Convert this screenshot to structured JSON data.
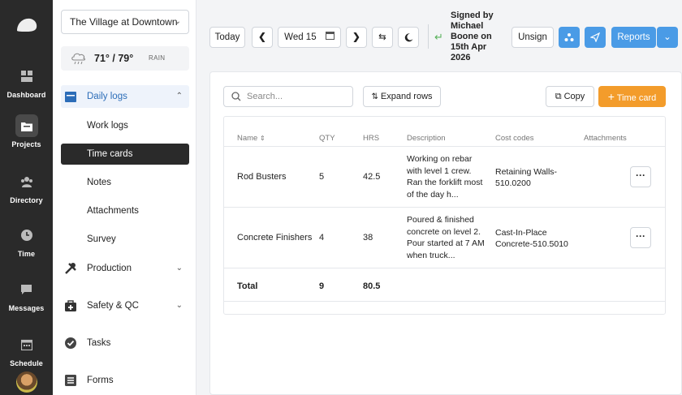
{
  "rail": {
    "items": [
      {
        "label": "Dashboard",
        "icon": "dashboard-icon"
      },
      {
        "label": "Projects",
        "icon": "folder-icon"
      },
      {
        "label": "Directory",
        "icon": "people-icon"
      },
      {
        "label": "Time",
        "icon": "clock-icon"
      },
      {
        "label": "Messages",
        "icon": "chat-icon"
      },
      {
        "label": "Schedule",
        "icon": "calendar-icon"
      }
    ]
  },
  "sidebar": {
    "project": "The Village at Downtown",
    "weather": {
      "temp": "71° / 79°",
      "condition": "RAIN"
    },
    "daily_logs": "Daily logs",
    "sub_items": [
      "Work logs",
      "Time cards",
      "Notes",
      "Attachments",
      "Survey"
    ],
    "sections": [
      "Production",
      "Safety & QC",
      "Tasks",
      "Forms"
    ]
  },
  "topbar": {
    "today": "Today",
    "date": "Wed 15",
    "signed_text": "Signed by Michael Boone on 15th Apr 2026",
    "unsign": "Unsign",
    "reports": "Reports"
  },
  "toolbar": {
    "search_placeholder": "Search...",
    "expand_rows": "Expand rows",
    "copy": "Copy",
    "time_card": "Time card"
  },
  "table": {
    "headers": [
      "Name",
      "QTY",
      "HRS",
      "Description",
      "Cost codes",
      "Attachments"
    ],
    "rows": [
      {
        "name": "Rod Busters",
        "qty": "5",
        "hrs": "42.5",
        "desc": [
          "Working on rebar",
          "with level 1 crew.",
          "Ran the forklift most",
          "of the day h..."
        ],
        "cost": [
          "Retaining Walls-",
          "510.0200"
        ]
      },
      {
        "name": "Concrete Finishers",
        "qty": "4",
        "hrs": "38",
        "desc": [
          "Poured & finished",
          "concrete on level 2.",
          "Pour started at 7 AM",
          "when truck..."
        ],
        "cost": [
          "Cast-In-Place",
          "Concrete-510.5010"
        ]
      }
    ],
    "total": {
      "label": "Total",
      "qty": "9",
      "hrs": "80.5"
    }
  },
  "colors": {
    "accent": "#4a9be6",
    "orange": "#f39c2b",
    "rail": "#2a2a2a",
    "highlight": "#2c6db8"
  }
}
